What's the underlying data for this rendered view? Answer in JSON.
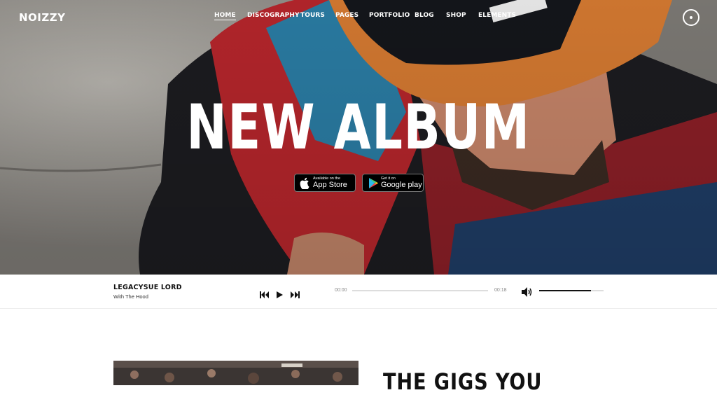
{
  "brand": {
    "logo": "NOIZZY"
  },
  "nav": {
    "items": [
      "HOME",
      "DISCOGRAPHY",
      "TOURS",
      "PAGES",
      "PORTFOLIO",
      "BLOG",
      "SHOP",
      "ELEMENTS"
    ],
    "active": "HOME"
  },
  "hero": {
    "title": "NEW ALBUM",
    "app_store": {
      "small": "Available on the",
      "big": "App Store"
    },
    "google_play": {
      "small": "Get it on",
      "big": "Google play"
    }
  },
  "player": {
    "track_title": "LEGACYSUE LORD",
    "track_subtitle": "With The Hood",
    "current_time": "00:00",
    "duration": "00:18",
    "progress_fraction": 0.0,
    "volume_fraction": 0.8
  },
  "section": {
    "heading": "THE GIGS YOU"
  },
  "icons": {
    "menu": "circle-menu-icon",
    "prev": "skip-back-icon",
    "play": "play-icon",
    "next": "skip-forward-icon",
    "volume": "speaker-icon",
    "apple": "apple-icon",
    "google_play": "google-play-icon"
  },
  "colors": {
    "accent": "#111111",
    "hero_text": "#ffffff"
  }
}
